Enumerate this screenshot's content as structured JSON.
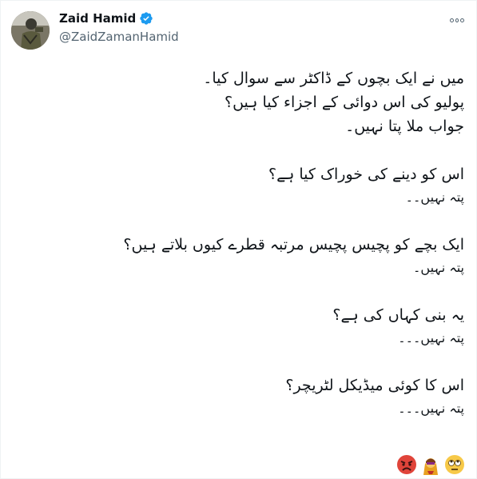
{
  "author": {
    "display_name": "Zaid Hamid",
    "handle": "@ZaidZamanHamid",
    "verified": true
  },
  "icons": {
    "verified": "verified-badge-icon",
    "more": "more-options-icon"
  },
  "tweet": {
    "paragraphs": [
      {
        "lines": [
          "میں نے ایک بچوں کے ڈاکٹر سے سوال کیا۔",
          "پولیو کی اس دوائی کے اجزاء کیا ہیں؟",
          "جواب ملا پتا نہیں۔"
        ]
      },
      {
        "lines": [
          "اس کو دینے کی خوراک کیا ہے؟",
          "پتہ نہیں۔۔"
        ]
      },
      {
        "lines": [
          "ایک بچے کو پچیس پچیس مرتبہ قطرے کیوں بلاتے ہیں؟",
          "پتہ نہیں۔"
        ]
      },
      {
        "lines": [
          "یہ بنی کہاں کی ہے؟",
          "پتہ نہیں۔۔۔"
        ]
      },
      {
        "lines": [
          "اس کا کوئی میڈیکل لٹریچر؟",
          "پتہ نہیں۔۔۔"
        ]
      }
    ],
    "emojis": [
      "angry-face-emoji",
      "woman-supervillain-emoji",
      "face-with-rolling-eyes-emoji"
    ]
  },
  "colors": {
    "verified_blue": "#1d9bf0",
    "handle_gray": "#536471",
    "text": "#0f1419"
  }
}
